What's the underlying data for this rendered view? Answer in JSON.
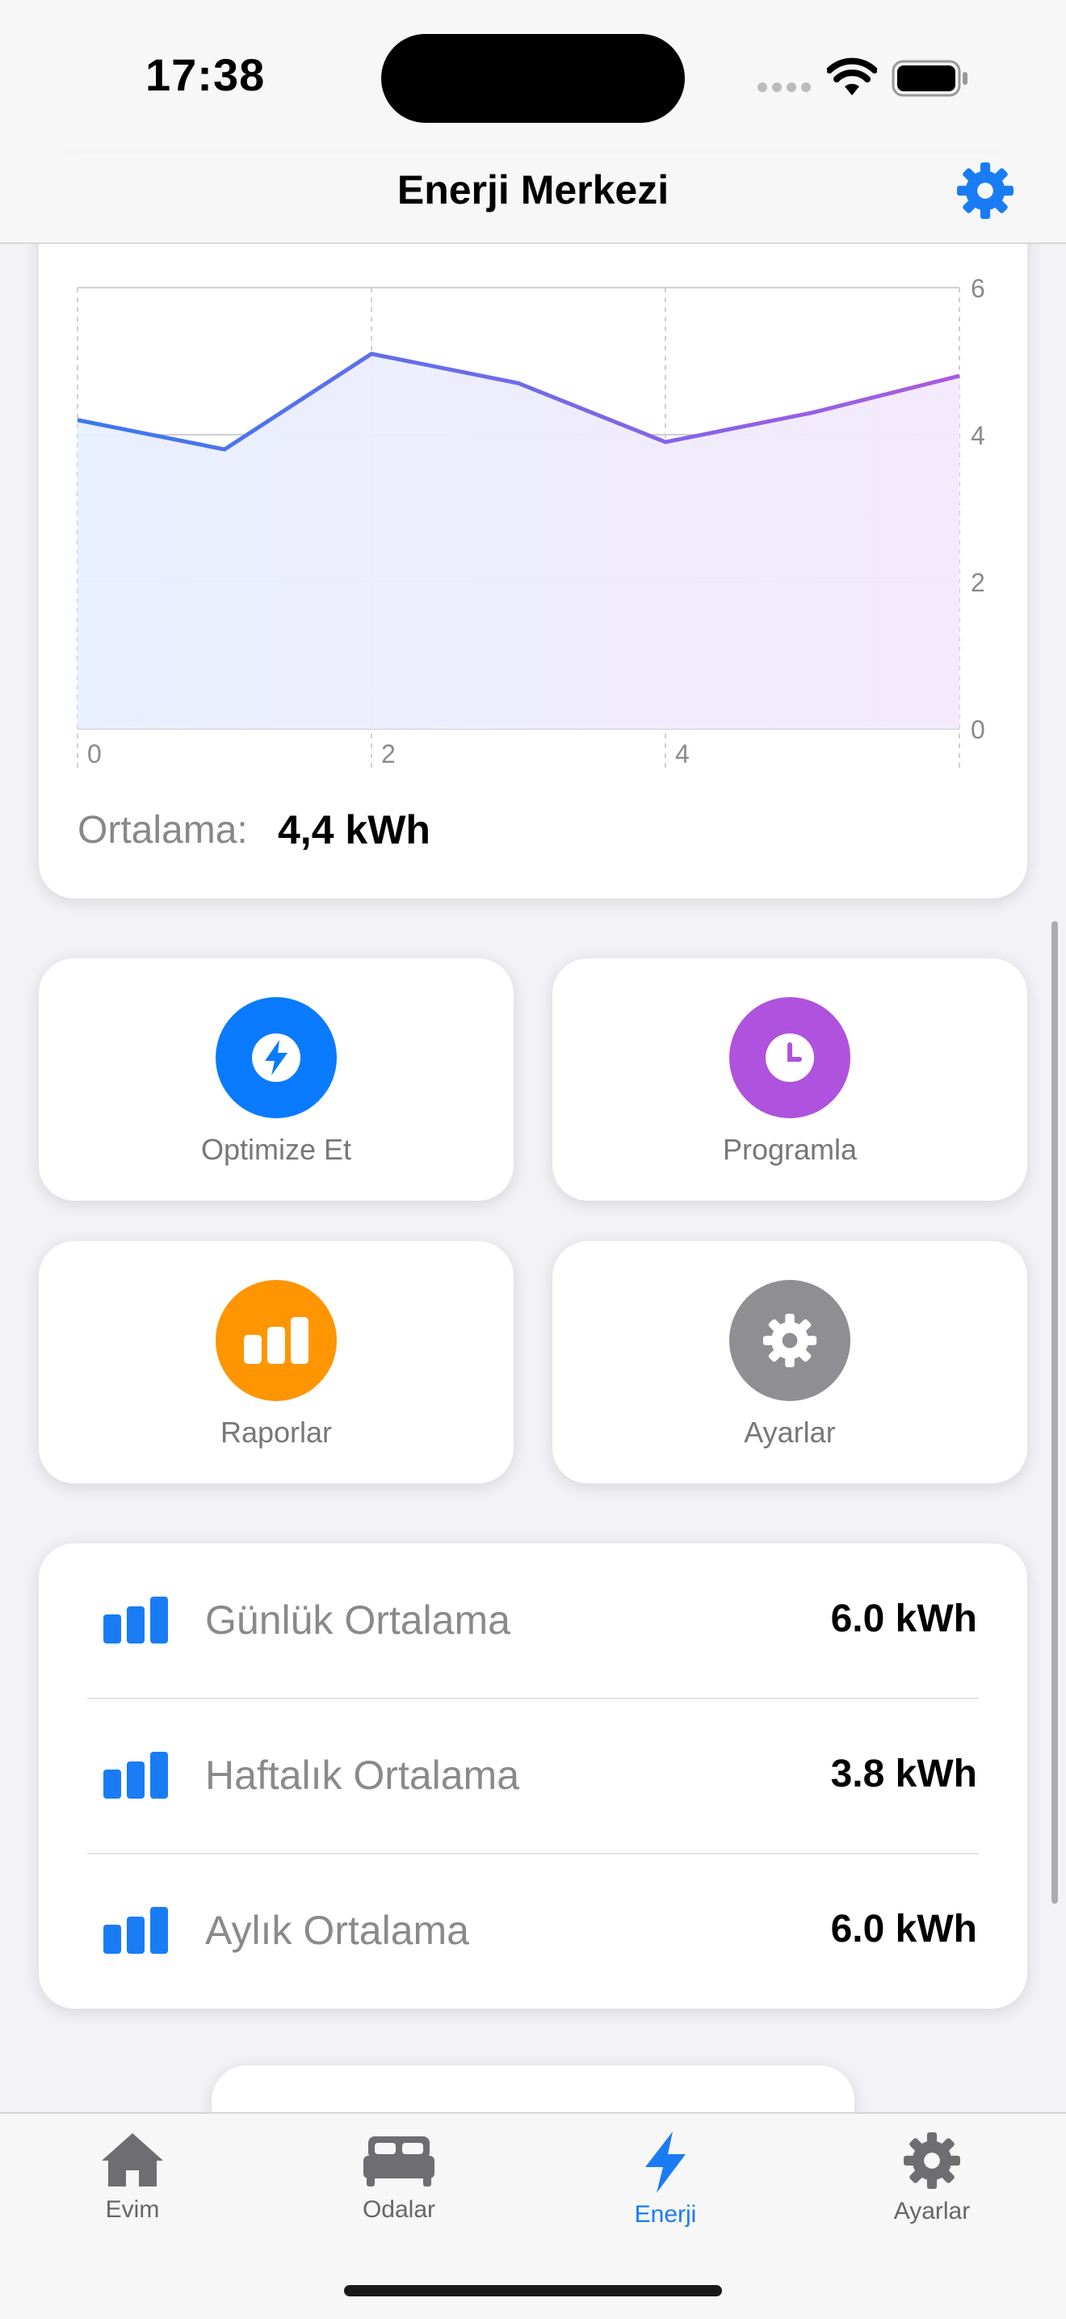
{
  "status_bar": {
    "time": "17:38"
  },
  "nav": {
    "title": "Enerji Merkezi",
    "settings_icon": "gear-icon"
  },
  "colors": {
    "accent": "#1a7cf5",
    "line_start": "#3a78f0",
    "line_end": "#a95be0",
    "optimize": "#0a7aff",
    "schedule": "#af52de",
    "reports": "#ff9500",
    "settings": "#8e8e93"
  },
  "chart_data": {
    "type": "area",
    "x": [
      0,
      1,
      2,
      3,
      4,
      5,
      6
    ],
    "values": [
      4.2,
      3.8,
      5.1,
      4.7,
      3.9,
      4.3,
      4.8
    ],
    "x_ticks": [
      "0",
      "2",
      "4"
    ],
    "y_ticks": [
      "0",
      "2",
      "4",
      "6"
    ],
    "xlim": [
      0,
      6
    ],
    "ylim": [
      0,
      6
    ],
    "y_axis_side": "right",
    "grid": true
  },
  "summary": {
    "label": "Ortalama:",
    "value": "4,4 kWh"
  },
  "actions": [
    {
      "label": "Optimize Et",
      "icon": "bolt-icon"
    },
    {
      "label": "Programla",
      "icon": "clock-icon"
    },
    {
      "label": "Raporlar",
      "icon": "bar-chart-icon"
    },
    {
      "label": "Ayarlar",
      "icon": "gear-icon"
    }
  ],
  "stats": [
    {
      "label": "Günlük Ortalama",
      "value": "6.0 kWh",
      "icon": "bar-chart-icon"
    },
    {
      "label": "Haftalık Ortalama",
      "value": "3.8 kWh",
      "icon": "bar-chart-icon"
    },
    {
      "label": "Aylık Ortalama",
      "value": "6.0 kWh",
      "icon": "bar-chart-icon"
    }
  ],
  "tabs": [
    {
      "label": "Evim",
      "icon": "house-icon",
      "active": false
    },
    {
      "label": "Odalar",
      "icon": "bed-icon",
      "active": false
    },
    {
      "label": "Enerji",
      "icon": "bolt-icon",
      "active": true
    },
    {
      "label": "Ayarlar",
      "icon": "gear-icon",
      "active": false
    }
  ]
}
